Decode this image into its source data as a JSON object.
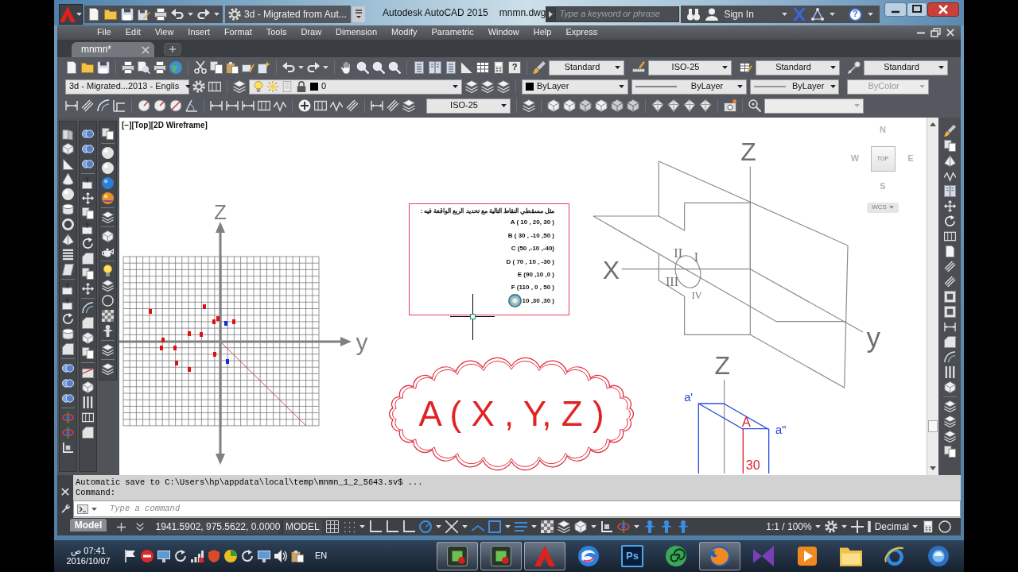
{
  "title_bar": {
    "workspace": "3d - Migrated from Aut...",
    "app_title": "Autodesk AutoCAD 2015",
    "file_name": "mnmn.dwg",
    "search": {
      "placeholder": "Type a keyword or phrase"
    },
    "sign_in": "Sign In",
    "help": "?"
  },
  "menu": [
    "File",
    "Edit",
    "View",
    "Insert",
    "Format",
    "Tools",
    "Draw",
    "Dimension",
    "Modify",
    "Parametric",
    "Window",
    "Help",
    "Express"
  ],
  "file_tabs": [
    {
      "label": "mnmn*",
      "selected": true
    }
  ],
  "toolbars": {
    "help": "?",
    "styles": [
      {
        "kind": "text",
        "value": "Standard"
      },
      {
        "kind": "dimension",
        "value": "ISO-25"
      },
      {
        "kind": "table",
        "value": "Standard"
      },
      {
        "kind": "multileader",
        "value": "Standard"
      }
    ],
    "workspace": "3d - Migrated...2013 - Englis",
    "layer": "0",
    "properties": [
      {
        "kind": "color",
        "value": "ByLayer",
        "disabled": false
      },
      {
        "kind": "linetype",
        "value": "ByLayer",
        "disabled": false
      },
      {
        "kind": "lineweight",
        "value": "ByLayer",
        "disabled": false
      },
      {
        "kind": "plot_style",
        "value": "ByColor",
        "disabled": true
      }
    ],
    "dimension_style": "ISO-25"
  },
  "viewport": {
    "controls": "[−][Top][2D Wireframe]",
    "viewcube": {
      "north": "N",
      "west": "W",
      "face": "TOP",
      "east": "E",
      "south": "S",
      "ucs": "WCS"
    }
  },
  "drawing": {
    "axes_sketch": {
      "z_label": "Z",
      "y_label": "y"
    },
    "exercise": {
      "heading": "مثل مسقطي النقاط التالية مع تحديد الربع الواقعة فيه :",
      "points": [
        "A ( 10 , 20, 30 )",
        "B ( 30 , -10 ,50 )",
        "C (50 ,-10 ,-40)",
        "D ( 70 , 10 , -30 )",
        "E (90 ,10 ,0 )",
        "F (110 , 0 , 50 )",
        "10 ,30 ,30 )"
      ]
    },
    "cloud_text": "A ( X , Y, Z )",
    "quadrant_sketch": {
      "z_label": "Z",
      "x_label": "X",
      "y_label": "y",
      "quadrants": [
        "II",
        "I",
        "III",
        "IV"
      ]
    },
    "projection_sketch": {
      "z_label": "Z",
      "labels": [
        {
          "text": "a'",
          "color": "#2a45d0"
        },
        {
          "text": "a\"",
          "color": "#2a45d0"
        },
        {
          "text": "A",
          "color": "#e02030"
        },
        {
          "text": "30",
          "color": "#e02030"
        }
      ]
    }
  },
  "command_line": {
    "history": [
      "Automatic save to C:\\Users\\hp\\appdata\\local\\temp\\mnmn_1_2_5643.sv$ ...",
      "Command:"
    ],
    "placeholder": "Type a command"
  },
  "status_bar": {
    "layout_tabs": [
      {
        "label": "Model",
        "selected": true
      }
    ],
    "coordinates": "1941.5902, 975.5622, 0.0000",
    "space": "MODEL",
    "annotation_scale": "1:1 / 100%",
    "units": "Decimal"
  },
  "taskbar": {
    "time": "07:41 ص",
    "date": "2016/10/07",
    "language": "EN",
    "apps": [
      {
        "kind": "film",
        "running": true
      },
      {
        "kind": "film",
        "running": true
      },
      {
        "kind": "cad",
        "running": true
      },
      {
        "kind": "swirl",
        "running": false
      },
      {
        "kind": "tile",
        "label": "Ps",
        "running": false
      },
      {
        "kind": "spiral",
        "running": false
      },
      {
        "kind": "fox",
        "running": true
      },
      {
        "kind": "bowtie",
        "running": false
      },
      {
        "kind": "play",
        "running": false
      },
      {
        "kind": "folder",
        "running": false
      },
      {
        "kind": "orbit",
        "running": false
      },
      {
        "kind": "orb",
        "running": false
      }
    ]
  }
}
